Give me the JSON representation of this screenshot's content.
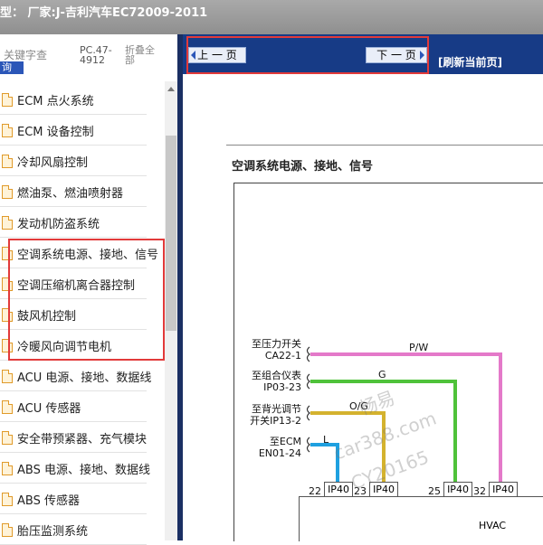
{
  "window": {
    "title": "型：  厂家:J-吉利汽车EC72009-2011"
  },
  "toolbar": {
    "keyword_label": "关键字查",
    "query_label": "询",
    "pc_code": "PC.47-4912",
    "fold_label": "折叠全部"
  },
  "sidebar": {
    "items": [
      {
        "label": "ECM 点火系统"
      },
      {
        "label": "ECM 设备控制"
      },
      {
        "label": "冷却风扇控制"
      },
      {
        "label": "燃油泵、燃油喷射器"
      },
      {
        "label": "发动机防盗系统"
      },
      {
        "label": "空调系统电源、接地、信号"
      },
      {
        "label": "空调压缩机离合器控制"
      },
      {
        "label": "鼓风机控制"
      },
      {
        "label": "冷暖风向调节电机"
      },
      {
        "label": "ACU 电源、接地、数据线"
      },
      {
        "label": "ACU 传感器"
      },
      {
        "label": "安全带预紧器、充气模块"
      },
      {
        "label": "ABS 电源、接地、数据线"
      },
      {
        "label": "ABS 传感器"
      },
      {
        "label": "胎压监测系统"
      }
    ]
  },
  "nav": {
    "prev_label": "上 一 页",
    "next_label": "下 一 页",
    "refresh_label": "[刷新当前页]"
  },
  "diagram": {
    "title": "空调系统电源、接地、信号",
    "sources": [
      {
        "label": "至压力开关\nCA22-1",
        "wire": "P/W",
        "color": "#e479c9",
        "pin": "32"
      },
      {
        "label": "至组合仪表\nIP03-23",
        "wire": "G",
        "color": "#4fc23a",
        "pin": "25"
      },
      {
        "label": "至背光调节\n开关IP13-2",
        "wire": "O/G",
        "color": "#d4b22e",
        "pin": "23"
      },
      {
        "label": "至ECM\nEN01-24",
        "wire": "L",
        "color": "#1ea0e0",
        "pin": "22"
      }
    ],
    "connector_label": "IP40",
    "module_label": "HVAC",
    "watermarks": [
      "畅易",
      "car388.com",
      "CY20165"
    ]
  }
}
